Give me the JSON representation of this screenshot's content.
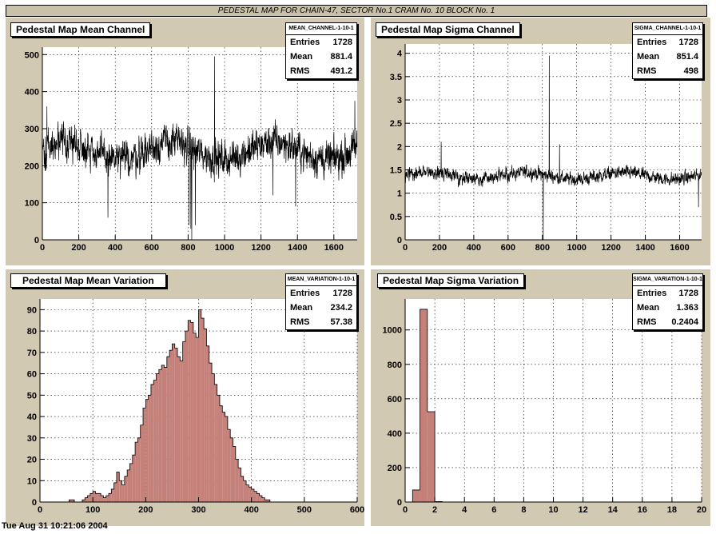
{
  "banner": "PEDESTAL MAP FOR CHAIN-47, SECTOR No.1 CRAM No. 10 BLOCK No. 1",
  "footer": "Tue Aug 31 10:21:06 2004",
  "colors": {
    "pad_bg": "#d2c9b2",
    "frame_bg": "#ffffff",
    "hist_fill": "#c48079",
    "line": "#000000"
  },
  "chart_data": [
    {
      "type": "line",
      "title": "Pedestal Map Mean Channel",
      "stats": {
        "name": "MEAN_CHANNEL-1-10-1",
        "entries": "1728",
        "mean": "881.4",
        "rms": "491.2"
      },
      "stat_labels": {
        "entries": "Entries",
        "mean": "Mean",
        "rms": "RMS"
      },
      "xlim": [
        0,
        1728
      ],
      "ylim": [
        0,
        520
      ],
      "xticks": [
        0,
        200,
        400,
        600,
        800,
        1000,
        1200,
        1400,
        1600
      ],
      "yticks": [
        0,
        100,
        200,
        300,
        400,
        500
      ],
      "grid": true,
      "n_channels": 1728,
      "baseline": 240,
      "noise": 95,
      "spikes": [
        {
          "x": 820,
          "y": 0
        },
        {
          "x": 815,
          "y": 30
        },
        {
          "x": 805,
          "y": 40
        },
        {
          "x": 945,
          "y": 495
        },
        {
          "x": 840,
          "y": 40
        },
        {
          "x": 360,
          "y": 60
        },
        {
          "x": 1715,
          "y": 375
        },
        {
          "x": 25,
          "y": 360
        },
        {
          "x": 1390,
          "y": 90
        },
        {
          "x": 1265,
          "y": 120
        }
      ]
    },
    {
      "type": "line",
      "title": "Pedestal Map Sigma Channel",
      "stats": {
        "name": "SIGMA_CHANNEL-1-10-1",
        "entries": "1728",
        "mean": "851.4",
        "rms": "498"
      },
      "stat_labels": {
        "entries": "Entries",
        "mean": "Mean",
        "rms": "RMS"
      },
      "xlim": [
        0,
        1728
      ],
      "ylim": [
        0,
        4.2
      ],
      "xticks": [
        0,
        200,
        400,
        600,
        800,
        1000,
        1200,
        1400,
        1600
      ],
      "yticks": [
        0,
        0.5,
        1,
        1.5,
        2,
        2.5,
        3,
        3.5,
        4
      ],
      "grid": true,
      "n_channels": 1728,
      "baseline": 1.37,
      "noise": 0.28,
      "spikes": [
        {
          "x": 805,
          "y": 0
        },
        {
          "x": 840,
          "y": 3.95
        },
        {
          "x": 1710,
          "y": 0.7
        },
        {
          "x": 900,
          "y": 2.05
        },
        {
          "x": 210,
          "y": 2.1
        }
      ]
    },
    {
      "type": "bar",
      "title": "Pedestal Map Mean Variation",
      "stats": {
        "name": "MEAN_VARIATION-1-10-1",
        "entries": "1728",
        "mean": "234.2",
        "rms": "57.38"
      },
      "stat_labels": {
        "entries": "Entries",
        "mean": "Mean",
        "rms": "RMS"
      },
      "xlim": [
        0,
        600
      ],
      "ylim": [
        0,
        95
      ],
      "xticks": [
        0,
        100,
        200,
        300,
        400,
        500,
        600
      ],
      "yticks": [
        0,
        10,
        20,
        30,
        40,
        50,
        60,
        70,
        80,
        90
      ],
      "grid": true,
      "bin_width": 5,
      "bin_start": 0,
      "values": [
        0,
        0,
        0,
        0,
        0,
        0,
        0,
        0,
        0,
        0,
        0,
        1,
        1,
        0,
        0,
        0,
        1,
        2,
        3,
        4,
        5,
        4,
        4,
        3,
        2,
        3,
        4,
        6,
        9,
        14,
        10,
        8,
        12,
        15,
        18,
        22,
        28,
        30,
        36,
        44,
        48,
        50,
        55,
        57,
        60,
        62,
        64,
        63,
        68,
        71,
        74,
        72,
        68,
        66,
        75,
        80,
        85,
        84,
        79,
        77,
        90,
        86,
        81,
        73,
        65,
        60,
        55,
        50,
        45,
        42,
        40,
        34,
        30,
        26,
        20,
        16,
        12,
        10,
        8,
        7,
        6,
        5,
        4,
        3,
        2,
        1,
        1,
        0,
        0,
        0,
        0,
        0,
        0,
        0,
        0,
        0,
        0,
        0,
        0,
        0,
        0,
        0,
        0,
        0,
        0,
        0,
        0,
        0,
        0,
        0,
        0,
        0,
        0,
        0,
        0,
        0,
        0,
        0,
        0,
        0
      ]
    },
    {
      "type": "bar",
      "title": "Pedestal Map Sigma Variation",
      "stats": {
        "name": "SIGMA_VARIATION-1-10-1",
        "entries": "1728",
        "mean": "1.363",
        "rms": "0.2404"
      },
      "stat_labels": {
        "entries": "Entries",
        "mean": "Mean",
        "rms": "RMS"
      },
      "xlim": [
        0,
        20
      ],
      "ylim": [
        0,
        1180
      ],
      "xticks": [
        0,
        2,
        4,
        6,
        8,
        10,
        12,
        14,
        16,
        18,
        20
      ],
      "yticks": [
        0,
        200,
        400,
        600,
        800,
        1000
      ],
      "grid": true,
      "bin_width": 0.5,
      "bin_start": 0,
      "values": [
        0,
        70,
        1120,
        525,
        3,
        0,
        0,
        0,
        0,
        0,
        0,
        0,
        0,
        0,
        0,
        0,
        0,
        0,
        0,
        0,
        0,
        0,
        0,
        0,
        0,
        0,
        0,
        0,
        0,
        0,
        0,
        0,
        0,
        0,
        0,
        0,
        0,
        0,
        0,
        0
      ]
    }
  ]
}
